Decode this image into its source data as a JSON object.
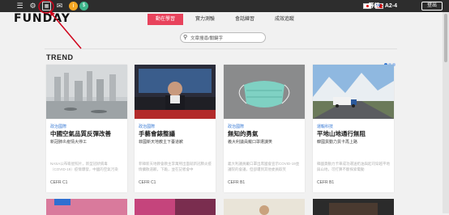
{
  "topbar": {
    "level_text": "等級 : A2-4",
    "logout_label": "登出",
    "icons": [
      "menu-icon",
      "gear-icon",
      "calendar-icon",
      "mail-icon",
      "info-icon",
      "coin-icon"
    ]
  },
  "header": {
    "logo": "FUNDAY",
    "tabs": [
      {
        "label": "動在學習",
        "active": true
      },
      {
        "label": "實力測驗",
        "active": false
      },
      {
        "label": "會話練習",
        "active": false
      },
      {
        "label": "成效追蹤",
        "active": false
      }
    ],
    "search_placeholder": "文章搜尋/關鍵字"
  },
  "trend": {
    "heading": "TREND",
    "cards": [
      {
        "category": "政治國際",
        "title": "中國空氣品質反彈改善",
        "subtitle": "新冠肺炎疫情大停工",
        "body": "NASA公布衛星照片，新型冠狀病毒（COVID-19）疫情爆發，中國的空氣污染",
        "level": "CEFR C1",
        "image": "smog-city"
      },
      {
        "category": "政治國際",
        "title": "手藝會錶整議",
        "subtitle": "菲國新天地教主下臺道歉",
        "body": "菲韓新天地教會教主李萬熙出面就新冠肺炎疫情擴散道歉，下跪，並在記者會中",
        "level": "CEFR C1",
        "image": "press-conference"
      },
      {
        "category": "政治國際",
        "title": "無知的勇氣",
        "subtitle": "義大利議員戴口罩遭譏笑",
        "body": "義大利議員戴口罩出席國會宣示COVID-19並議院的會議，但卻遭到其他委員取笑",
        "level": "CEFR B1",
        "image": "face-mask"
      },
      {
        "category": "運輸科技",
        "title": "平地山地通行無阻",
        "subtitle": "韓國貨動力貨卡再上路",
        "body": "韓國貨動力卡車成功運送奶油與起司穿越平地與山地，可打算不斷探索電動",
        "level": "CEFR B1",
        "image": "truck-mountain"
      }
    ]
  },
  "colors": {
    "accent": "#e8435c",
    "topbar": "#2d2d2d",
    "link": "#3a7bd5",
    "annotation": "#d0021b"
  }
}
